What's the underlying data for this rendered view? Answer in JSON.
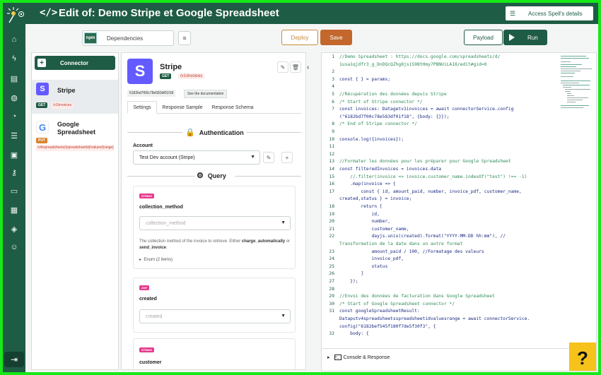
{
  "header": {
    "title": "Edit of: Demo Stripe et Google Spreadsheet",
    "access_label": "Access Spell's details"
  },
  "toolbar": {
    "dependencies_label": "Dependencies",
    "npm_label": "npm",
    "deploy_label": "Deploy",
    "save_label": "Save",
    "payload_label": "Payload",
    "run_label": "Run"
  },
  "sidebar": {
    "connector_button": "Connector",
    "items": [
      {
        "name": "Stripe",
        "method": "GET",
        "path": "/v1/invoices",
        "logo": "S",
        "color": "#635bff"
      },
      {
        "name": "Google Spreadsheet",
        "method": "PUT",
        "path": "/v4/spreadsheets/{spreadsheetId}/values/{range}",
        "logo": "G",
        "color": "#ffffff"
      }
    ]
  },
  "config": {
    "name": "Stripe",
    "method": "GET",
    "endpoint": "/v1/invoices",
    "logo": "S",
    "id": "6182bd7f00c78e583df01f18",
    "doc_label": "See the documentation",
    "tabs": [
      "Settings",
      "Response Sample",
      "Response Schema"
    ],
    "auth_title": "Authentication",
    "account_label": "Account",
    "account_value": "Test Dev account (Stripe)",
    "query_title": "Query",
    "fields": [
      {
        "type": "STRING",
        "name": "collection_method",
        "placeholder": "collection_method",
        "desc_pre": "The collection method of the invoice to retrieve. Either ",
        "opt1": "charge_automatically",
        "desc_mid": " or ",
        "opt2": "send_invoice",
        "desc_post": ".",
        "enum": "Enum (2 items)"
      },
      {
        "type": "ANY",
        "name": "created",
        "placeholder": "created"
      },
      {
        "type": "STRING",
        "name": "customer"
      }
    ]
  },
  "code": {
    "lines": [
      {
        "n": "1",
        "t": "//Demo Spreadsheet : https://docs.google.com/spreadsheets/d/",
        "c": true
      },
      {
        "n": "",
        "t": "1usa1qjdfr3_g_DnDQcQZhg8js1S9BtHmy7PBNUiLA18/edit#gid=0",
        "c": true
      },
      {
        "n": "2",
        "t": ""
      },
      {
        "n": "3",
        "t": "const { } = params;"
      },
      {
        "n": "4",
        "t": ""
      },
      {
        "n": "5",
        "t": "//Récupération des données depuis Stripe",
        "c": true
      },
      {
        "n": "6",
        "t": "/* Start of Stripe connector */",
        "c": true
      },
      {
        "n": "7",
        "t": "const invoices: Datagetv1invoices = await connectorService.config"
      },
      {
        "n": "",
        "t": "(\"6182bd7f00c78e583df01f18\", {body: {}});"
      },
      {
        "n": "8",
        "t": "/* End of Stripe connector */",
        "c": true
      },
      {
        "n": "9",
        "t": ""
      },
      {
        "n": "10",
        "t": "console.log({invoices});"
      },
      {
        "n": "11",
        "t": ""
      },
      {
        "n": "12",
        "t": ""
      },
      {
        "n": "13",
        "t": "//Formater les données pour les préparer pour Google Spreadsheet",
        "c": true
      },
      {
        "n": "14",
        "t": "const filteredInvoices = invoices.data"
      },
      {
        "n": "15",
        "t": "    //.filter(invoice => invoice.customer_name.indexOf(\"test\") !== -1)",
        "c": true
      },
      {
        "n": "16",
        "t": "    .map(invoice => {"
      },
      {
        "n": "17",
        "t": "        const { id, amount_paid, number, invoice_pdf, customer_name,"
      },
      {
        "n": "",
        "t": "created,status } = invoice;"
      },
      {
        "n": "18",
        "t": "        return ["
      },
      {
        "n": "19",
        "t": "            id,"
      },
      {
        "n": "20",
        "t": "            number,"
      },
      {
        "n": "21",
        "t": "            customer_name,"
      },
      {
        "n": "22",
        "t": "            dayjs.unix(created).format(\"YYYY-MM-DD hh:mm\"), //"
      },
      {
        "n": "",
        "t": "Transformation de la date dans un autre format",
        "c": true
      },
      {
        "n": "23",
        "t": "            amount_paid / 100, //Formatage des valeurs"
      },
      {
        "n": "24",
        "t": "            invoice_pdf,"
      },
      {
        "n": "25",
        "t": "            status"
      },
      {
        "n": "26",
        "t": "        ]"
      },
      {
        "n": "27",
        "t": "    });"
      },
      {
        "n": "28",
        "t": ""
      },
      {
        "n": "29",
        "t": "//Envoi des données de facturation dans Google Spreadsheet",
        "c": true
      },
      {
        "n": "30",
        "t": "/* Start of Google Spreadsheet connector */",
        "c": true
      },
      {
        "n": "31",
        "t": "const googleSpreadsheetResult:"
      },
      {
        "n": "",
        "t": "Dataputv4spreadsheetsspreadsheetidvaluesrange = await connectorService."
      },
      {
        "n": "",
        "t": "config(\"6182bef545f180f7de5f30f3\", {"
      },
      {
        "n": "32",
        "t": "    body: {"
      }
    ]
  },
  "console": {
    "label": "Console & Response"
  },
  "help": {
    "label": "?"
  }
}
